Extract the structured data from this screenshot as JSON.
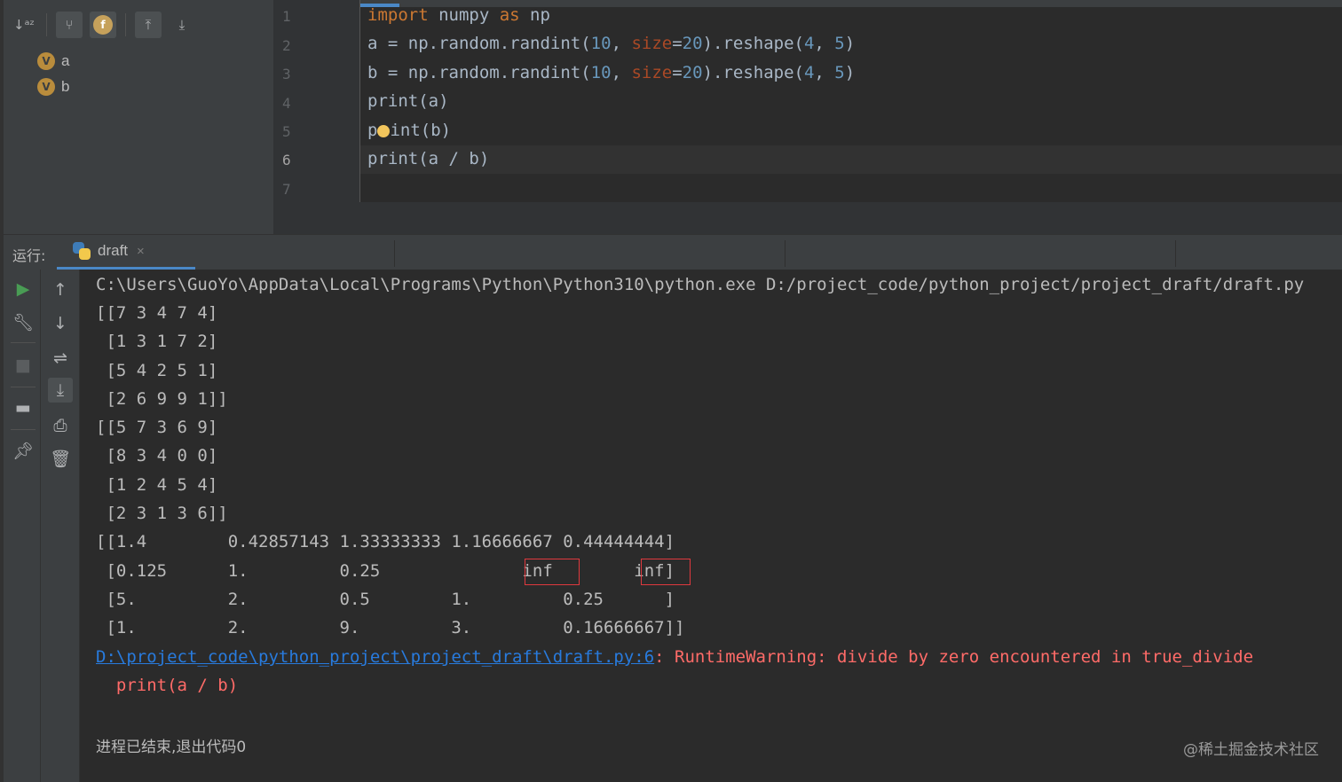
{
  "structure": {
    "items": [
      {
        "badge": "V",
        "label": "a"
      },
      {
        "badge": "V",
        "label": "b"
      }
    ]
  },
  "editor": {
    "line_numbers": [
      "1",
      "2",
      "3",
      "4",
      "5",
      "6",
      "7"
    ]
  },
  "run_window": {
    "label": "运行:",
    "tab_name": "draft",
    "tab_close": "×"
  },
  "console": {
    "command": "C:\\Users\\GuoYo\\AppData\\Local\\Programs\\Python\\Python310\\python.exe D:/project_code/python_project/project_draft/draft.py",
    "output_lines": [
      "[[7 3 4 7 4]",
      " [1 3 1 7 2]",
      " [5 4 2 5 1]",
      " [2 6 9 9 1]]",
      "[[5 7 3 6 9]",
      " [8 3 4 0 0]",
      " [1 2 4 5 4]",
      " [2 3 1 3 6]]",
      "[[1.4        0.42857143 1.33333333 1.16666667 0.44444444]",
      " [0.125      1.         0.25              inf        inf]",
      " [5.         2.         0.5        1.         0.25      ]",
      " [1.         2.         9.         3.         0.16666667]]"
    ],
    "warning_link": "D:\\project_code\\python_project\\project_draft\\draft.py:6",
    "warning_text": ": RuntimeWarning: divide by zero encountered in true_divide",
    "warning_code": "  print(a / b)",
    "exit_message": "进程已结束,退出代码0"
  },
  "watermark": "@稀土掘金技术社区",
  "colors": {
    "keyword": "#cc7832",
    "number": "#6897bb",
    "param": "#aa4926",
    "error": "#ff6b68",
    "link": "#287bde",
    "highlight_box": "#e0393e"
  }
}
